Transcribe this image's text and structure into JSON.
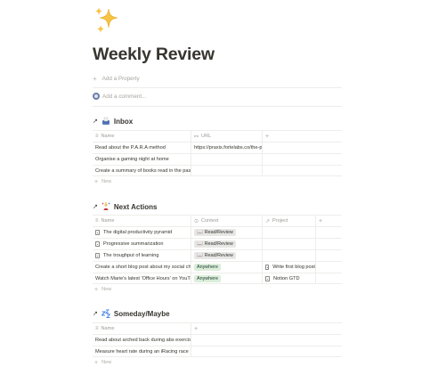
{
  "page": {
    "icon": "sparkles-icon",
    "title": "Weekly Review",
    "add_property": "Add a Property",
    "add_comment": "Add a comment..."
  },
  "colors": {
    "tag_gray": "#e7e7e5",
    "tag_green": "#dbeddb",
    "text": "#37352f",
    "muted": "#9b9a97"
  },
  "inbox": {
    "arrow": "↗",
    "icon": "inbox-tray-icon",
    "title": "Inbox",
    "columns": [
      "Name",
      "URL"
    ],
    "add_column": "+",
    "rows": [
      {
        "name": "Read about the P.A.R.A method",
        "url": "https://praxis.fortelabs.co/the-p"
      },
      {
        "name": "Organise a gaming night at home",
        "url": ""
      },
      {
        "name": "Create a summary of books read in the past",
        "url": ""
      }
    ],
    "new_label": "New"
  },
  "next_actions": {
    "arrow": "↗",
    "icon": "person-juggling-icon",
    "title": "Next Actions",
    "columns": [
      "Name",
      "Context",
      "Project"
    ],
    "add_column": "+",
    "rows": [
      {
        "name": "The digital productivity pyramid",
        "context": "Read/Review",
        "project": ""
      },
      {
        "name": "Progressive summarization",
        "context": "Read/Review",
        "project": ""
      },
      {
        "name": "The troughput of learning",
        "context": "Read/Review",
        "project": ""
      },
      {
        "name": "Create a short blog post about my social ch",
        "context": "Anywhere",
        "project": "Write first blog post"
      },
      {
        "name": "Watch Marie's latest 'Office Hours' on YouTu",
        "context": "Anywhere",
        "project": "Notion GTD"
      }
    ],
    "new_label": "New"
  },
  "someday": {
    "arrow": "↗",
    "icon": "zzz-icon",
    "title": "Someday/Maybe",
    "columns": [
      "Name"
    ],
    "add_column": "+",
    "rows": [
      {
        "name": "Read about arched back during abs exercis"
      },
      {
        "name": "Measure heart rate during an iRacing race"
      }
    ],
    "new_label": "New"
  }
}
